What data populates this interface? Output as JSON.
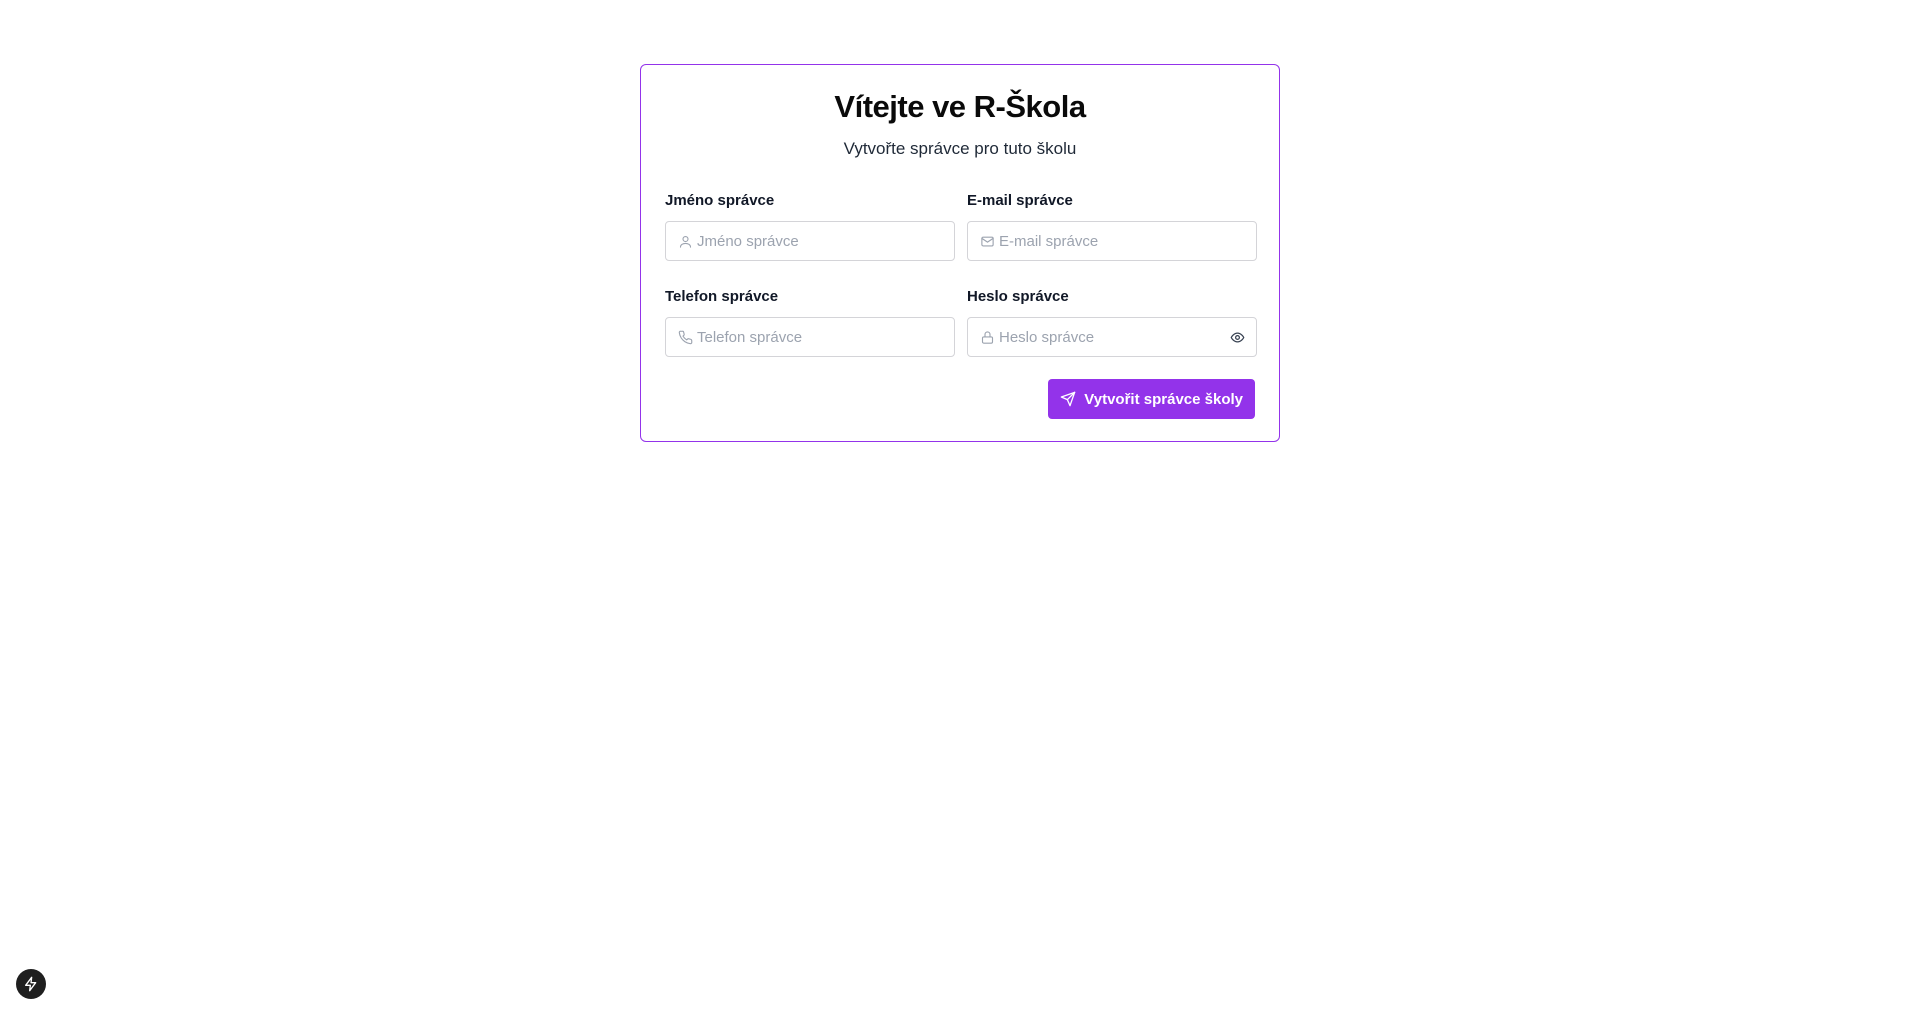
{
  "form": {
    "title": "Vítejte ve R-Škola",
    "subtitle": "Vytvořte správce pro tuto školu",
    "fields": {
      "name": {
        "label": "Jméno správce",
        "placeholder": "Jméno správce",
        "icon": "user-icon",
        "value": ""
      },
      "email": {
        "label": "E-mail správce",
        "placeholder": "E-mail správce",
        "icon": "mail-icon",
        "value": ""
      },
      "phone": {
        "label": "Telefon správce",
        "placeholder": "Telefon správce",
        "icon": "phone-icon",
        "value": ""
      },
      "password": {
        "label": "Heslo správce",
        "placeholder": "Heslo správce",
        "icon": "lock-icon",
        "toggle_icon": "eye-icon",
        "value": ""
      }
    },
    "submit_label": "Vytvořit správce školy",
    "submit_icon": "send-icon"
  },
  "dev_badge_icon": "lightning-icon",
  "colors": {
    "accent": "#9333ea",
    "border": "#d4d4d8",
    "placeholder": "#9ca3af",
    "badge": "#1f1f1f"
  }
}
